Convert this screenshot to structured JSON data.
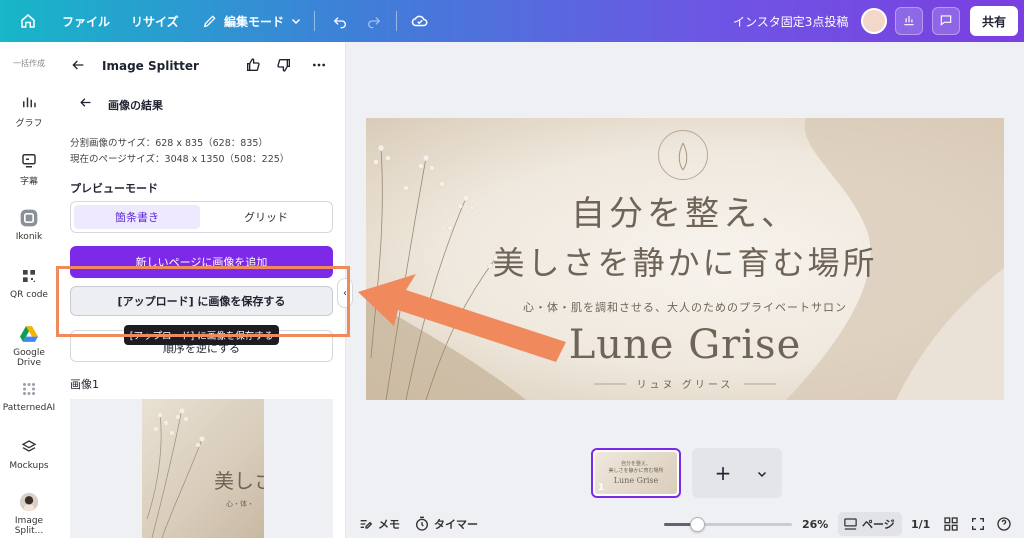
{
  "topbar": {
    "file_label": "ファイル",
    "resize_label": "リサイズ",
    "edit_mode_label": "編集モード",
    "project_title": "インスタ固定3点投稿",
    "share_label": "共有"
  },
  "rail": {
    "top_label": "一括作成",
    "items": [
      {
        "label": "グラフ",
        "icon": "chart-icon"
      },
      {
        "label": "字幕",
        "icon": "caption-icon"
      },
      {
        "label": "Ikonik",
        "icon": "ikonik-icon"
      },
      {
        "label": "QR code",
        "icon": "qr-icon"
      },
      {
        "label": "Google Drive",
        "icon": "google-drive-icon"
      },
      {
        "label": "PatternedAI",
        "icon": "pattern-icon"
      },
      {
        "label": "Mockups",
        "icon": "mockups-icon"
      },
      {
        "label": "Image Split...",
        "icon": "app-avatar-icon"
      }
    ]
  },
  "panel": {
    "title": "Image Splitter",
    "subtitle": "画像の結果",
    "split_size": "分割画像のサイズ：628 x 835（628：835）",
    "page_size": "現在のページサイズ：3048 x 1350（508：225）",
    "preview_mode_label": "プレビューモード",
    "mode_list": "箇条書き",
    "mode_grid": "グリッド",
    "add_page_button": "新しいページに画像を追加",
    "save_upload_button": "[アップロード] に画像を保存する",
    "tooltip": "[アップロード] に画像を保存する",
    "reverse_button": "順序を逆にする",
    "image_label": "画像1"
  },
  "design": {
    "headline_1": "自分を整え、",
    "headline_2": "美しさを静かに育む場所",
    "tagline": "心・体・肌を調和させる、大人のためのプライベートサロン",
    "brand": "Lune Grise",
    "brand_kana": "リュヌ グリース",
    "thumb_crop_text": "美しさ",
    "thumb_crop_small": "心・体・"
  },
  "pages": {
    "thumb_number": "1",
    "thumb_line_1": "自分を整え、",
    "thumb_line_2": "美しさを静かに育む場所",
    "thumb_brand": "Lune Grise",
    "add_symbol": "+"
  },
  "bottombar": {
    "notes_label": "メモ",
    "timer_label": "タイマー",
    "zoom_value": "26%",
    "zoom_fraction": 0.26,
    "pages_label": "ページ",
    "page_count": "1/1"
  },
  "colors": {
    "accent_purple": "#7d2ae8",
    "annotation_orange": "#f08a5d"
  }
}
